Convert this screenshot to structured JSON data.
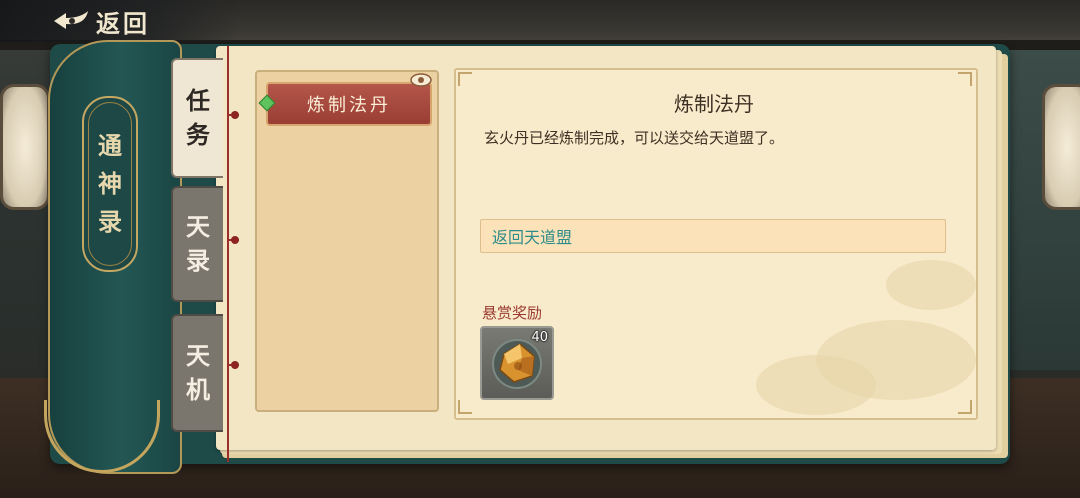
{
  "header": {
    "back_label": "返回"
  },
  "book": {
    "title_chars": [
      "通",
      "神",
      "录"
    ]
  },
  "tabs": [
    {
      "chars": [
        "任",
        "务"
      ],
      "active": true
    },
    {
      "chars": [
        "天",
        "录"
      ],
      "active": false
    },
    {
      "chars": [
        "天",
        "机"
      ],
      "active": false
    }
  ],
  "task_list": [
    {
      "label": "炼制法丹",
      "selected": true,
      "status_icon": "diamond-icon"
    }
  ],
  "detail": {
    "title": "炼制法丹",
    "description": "玄火丹已经炼制完成，可以送交给天道盟了。",
    "goal": "返回天道盟",
    "reward_label": "悬赏奖励",
    "rewards": [
      {
        "icon": "amber-gem-icon",
        "count": "40"
      }
    ]
  },
  "colors": {
    "accent_red": "#9a3d33",
    "goal_teal": "#2e8c8a",
    "cover_teal": "#1e4a48",
    "paper": "#f3e6c5"
  }
}
